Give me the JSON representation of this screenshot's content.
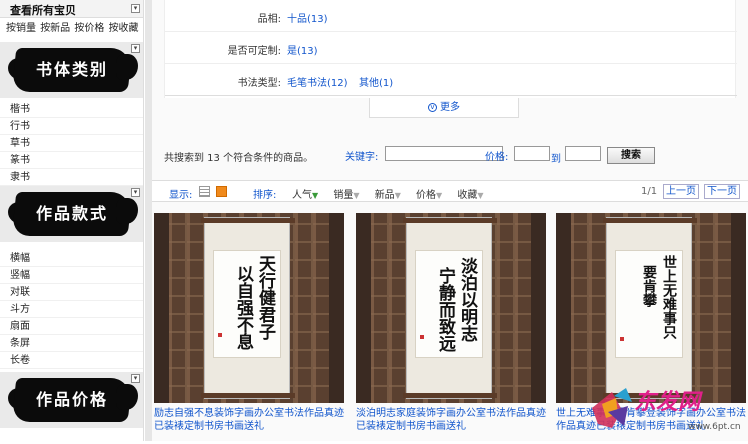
{
  "sidebar": {
    "all_items": "查看所有宝贝",
    "sort_links": [
      "按销量",
      "按新品",
      "按价格",
      "按收藏"
    ],
    "sections": [
      {
        "title": "书体类别",
        "items": [
          "楷书",
          "行书",
          "草书",
          "篆书",
          "隶书"
        ]
      },
      {
        "title": "作品款式",
        "items": [
          "横幅",
          "竖幅",
          "对联",
          "斗方",
          "扇面",
          "条屏",
          "长卷"
        ]
      },
      {
        "title": "作品价格",
        "items": []
      }
    ]
  },
  "filters": {
    "rows": [
      {
        "label": "品相:",
        "values": [
          "十品(13)"
        ]
      },
      {
        "label": "是否可定制:",
        "values": [
          "是(13)"
        ]
      },
      {
        "label": "书法类型:",
        "values": [
          "毛笔书法(12)",
          "其他(1)"
        ]
      }
    ],
    "more": "更多"
  },
  "search": {
    "count_text": "共搜索到 13 个符合条件的商品。",
    "keyword_label": "关键字:",
    "price_label": "价格:",
    "to": "到",
    "button": "搜索"
  },
  "toolbar": {
    "display": "显示:",
    "sort_label": "排序:",
    "sorts": [
      "人气",
      "销量",
      "新品",
      "价格",
      "收藏"
    ],
    "page": "1/1",
    "prev": "上一页",
    "next": "下一页"
  },
  "products": [
    {
      "title": "励志自强不息装饰字画办公室书法作品真迹已装裱定制书房书画送礼",
      "cols": [
        "天行健君子",
        "以自强不息"
      ]
    },
    {
      "title": "淡泊明志家庭装饰字画办公室书法作品真迹已装裱定制书房书画送礼",
      "cols": [
        "淡泊以明志",
        "宁静而致远"
      ]
    },
    {
      "title": "世上无难事只要肯攀登装饰字画办公室书法作品真迹已装裱定制书房书画送礼",
      "cols": [
        "世上无难事只",
        "要肯攀"
      ]
    }
  ],
  "watermark": {
    "brand": "东发网",
    "url": "www.6pt.cn"
  }
}
